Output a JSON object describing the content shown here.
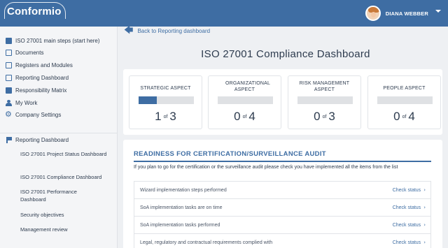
{
  "app": {
    "logo": "Conformio",
    "user": "DIANA WEBBER"
  },
  "sidebar": {
    "items": [
      {
        "label": "ISO 27001 main steps (start here)",
        "icon": "list-icon"
      },
      {
        "label": "Documents",
        "icon": "document-icon"
      },
      {
        "label": "Registers and Modules",
        "icon": "register-icon"
      },
      {
        "label": "Reporting Dashboard",
        "icon": "report-icon"
      },
      {
        "label": "Responsibility Matrix",
        "icon": "matrix-icon"
      },
      {
        "label": "My Work",
        "icon": "person-icon"
      },
      {
        "label": "Company Settings",
        "icon": "gear-icon"
      }
    ],
    "section": {
      "label": "Reporting Dashboard",
      "icon": "flag-icon"
    },
    "sub_items": [
      "ISO 27001 Project Status Dashboard",
      "ISO 27001 Compliance Dashboard",
      "ISO 27001 Performance Dashboard",
      "Security objectives",
      "Management review"
    ]
  },
  "main": {
    "back_label": "Back to Reporting dashboard",
    "title": "ISO 27001 Compliance Dashboard",
    "cards": [
      {
        "title": "STRATEGIC ASPECT",
        "done": "1",
        "of": "of",
        "total": "3",
        "progress": 0.33
      },
      {
        "title": "ORGANIZATIONAL ASPECT",
        "done": "0",
        "of": "of",
        "total": "4",
        "progress": 0
      },
      {
        "title": "RISK MANAGEMENT ASPECT",
        "done": "0",
        "of": "of",
        "total": "3",
        "progress": 0
      },
      {
        "title": "PEOPLE ASPECT",
        "done": "0",
        "of": "of",
        "total": "4",
        "progress": 0
      }
    ],
    "readiness": {
      "title": "READINESS FOR CERTIFICATION/SURVEILLANCE AUDIT",
      "description": "If you plan to go for the certification or the surveillance audit please check you have implemented all the items from the list",
      "rows": [
        {
          "label": "Wizard implementation steps performed",
          "link": "Check status"
        },
        {
          "label": "SoA implementation tasks are on time",
          "link": "Check status"
        },
        {
          "label": "SoA implementation tasks performed",
          "link": "Check status"
        },
        {
          "label": "Legal, regulatory and contractual requirements complied with",
          "link": "Check status"
        }
      ]
    }
  },
  "colors": {
    "brand": "#3e6da3",
    "background": "#eef0f3",
    "bar_empty": "#dfe1e4"
  }
}
